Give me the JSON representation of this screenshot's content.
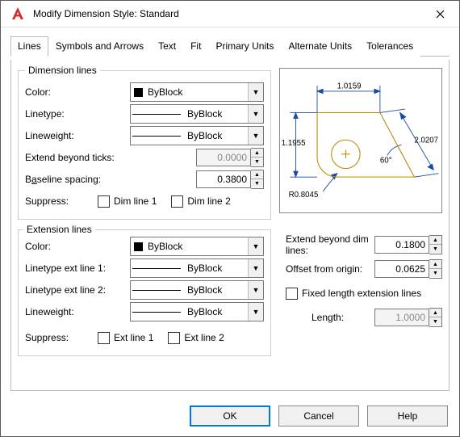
{
  "window": {
    "title": "Modify Dimension Style: Standard"
  },
  "tabs": {
    "lines": "Lines",
    "symbols": "Symbols and Arrows",
    "text": "Text",
    "fit": "Fit",
    "primary": "Primary Units",
    "alternate": "Alternate Units",
    "tolerances": "Tolerances"
  },
  "dimLines": {
    "legend": "Dimension lines",
    "color_lab": "Color:",
    "color_val": "ByBlock",
    "linetype_lab": "Linetype:",
    "linetype_val": "ByBlock",
    "lineweight_lab": "Lineweight:",
    "lineweight_val": "ByBlock",
    "extend_lab": "Extend beyond ticks:",
    "extend_val": "0.0000",
    "baseline_lab_pre": "B",
    "baseline_lab_u": "a",
    "baseline_lab_post": "seline spacing:",
    "baseline_val": "0.3800",
    "suppress_lab": "Suppress:",
    "sup1_pre": "Dim line ",
    "sup1_u": "1",
    "sup2_pre": "Dim line ",
    "sup2_u": "2"
  },
  "extLines": {
    "legend": "Extension lines",
    "color_lab": "Color:",
    "color_val": "ByBlock",
    "lt1_lab": "Linetype ext line 1:",
    "lt1_val": "ByBlock",
    "lt2_lab": "Linetype ext line 2:",
    "lt2_val": "ByBlock",
    "lineweight_lab": "Lineweight:",
    "lineweight_val": "ByBlock",
    "suppress_lab": "Suppress:",
    "sup1_pre": "Ext line ",
    "sup1_u": "1",
    "sup2_pre": "Ext line ",
    "sup2_u": "2",
    "ebdl_lab": "Extend beyond dim lines:",
    "ebdl_val": "0.1800",
    "ofo_lab": "Offset from origin:",
    "ofo_val": "0.0625",
    "fixed_lab": "Fixed length extension lines",
    "length_lab": "Length:",
    "length_val": "1.0000"
  },
  "preview": {
    "d_top": "1.0159",
    "d_left": "1.1955",
    "d_diag": "2.0207",
    "d_angle": "60°",
    "d_radius": "R0.8045"
  },
  "buttons": {
    "ok": "OK",
    "cancel": "Cancel",
    "help_u": "H",
    "help_rest": "elp"
  }
}
